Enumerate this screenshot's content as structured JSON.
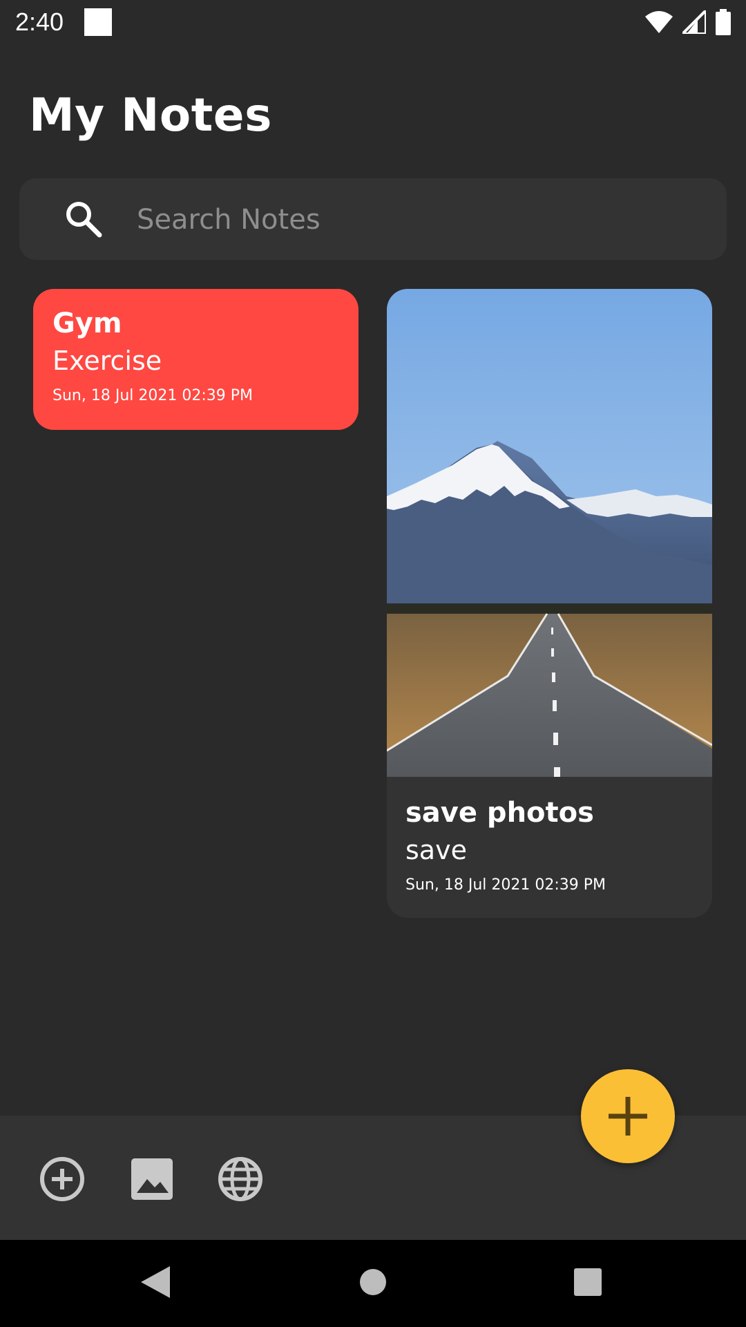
{
  "status_bar": {
    "time": "2:40",
    "icons": [
      "notification-square-icon",
      "wifi-icon",
      "cellular-signal-icon",
      "battery-icon"
    ]
  },
  "header": {
    "title": "My Notes"
  },
  "search": {
    "placeholder": "Search Notes",
    "icon": "search-icon"
  },
  "notes": [
    {
      "title": "Gym",
      "subtitle": "Exercise",
      "date": "Sun, 18 Jul 2021 02:39 PM",
      "color": "#ff4842",
      "has_image": false
    },
    {
      "title": "save photos",
      "subtitle": "save",
      "date": "Sun, 18 Jul 2021 02:39 PM",
      "color": "#333333",
      "has_image": true,
      "image_subject": "mountain-road-photo"
    }
  ],
  "toolbar": {
    "icons": [
      "add-circle-icon",
      "image-icon",
      "web-globe-icon"
    ]
  },
  "fab": {
    "icon": "plus-icon",
    "color": "#fbbf35"
  },
  "nav": {
    "icons": [
      "back-triangle-icon",
      "home-circle-icon",
      "recents-square-icon"
    ]
  },
  "colors": {
    "background": "#2a2a2a",
    "surface": "#333333",
    "accent": "#fbbf35",
    "note_red": "#ff4842"
  }
}
